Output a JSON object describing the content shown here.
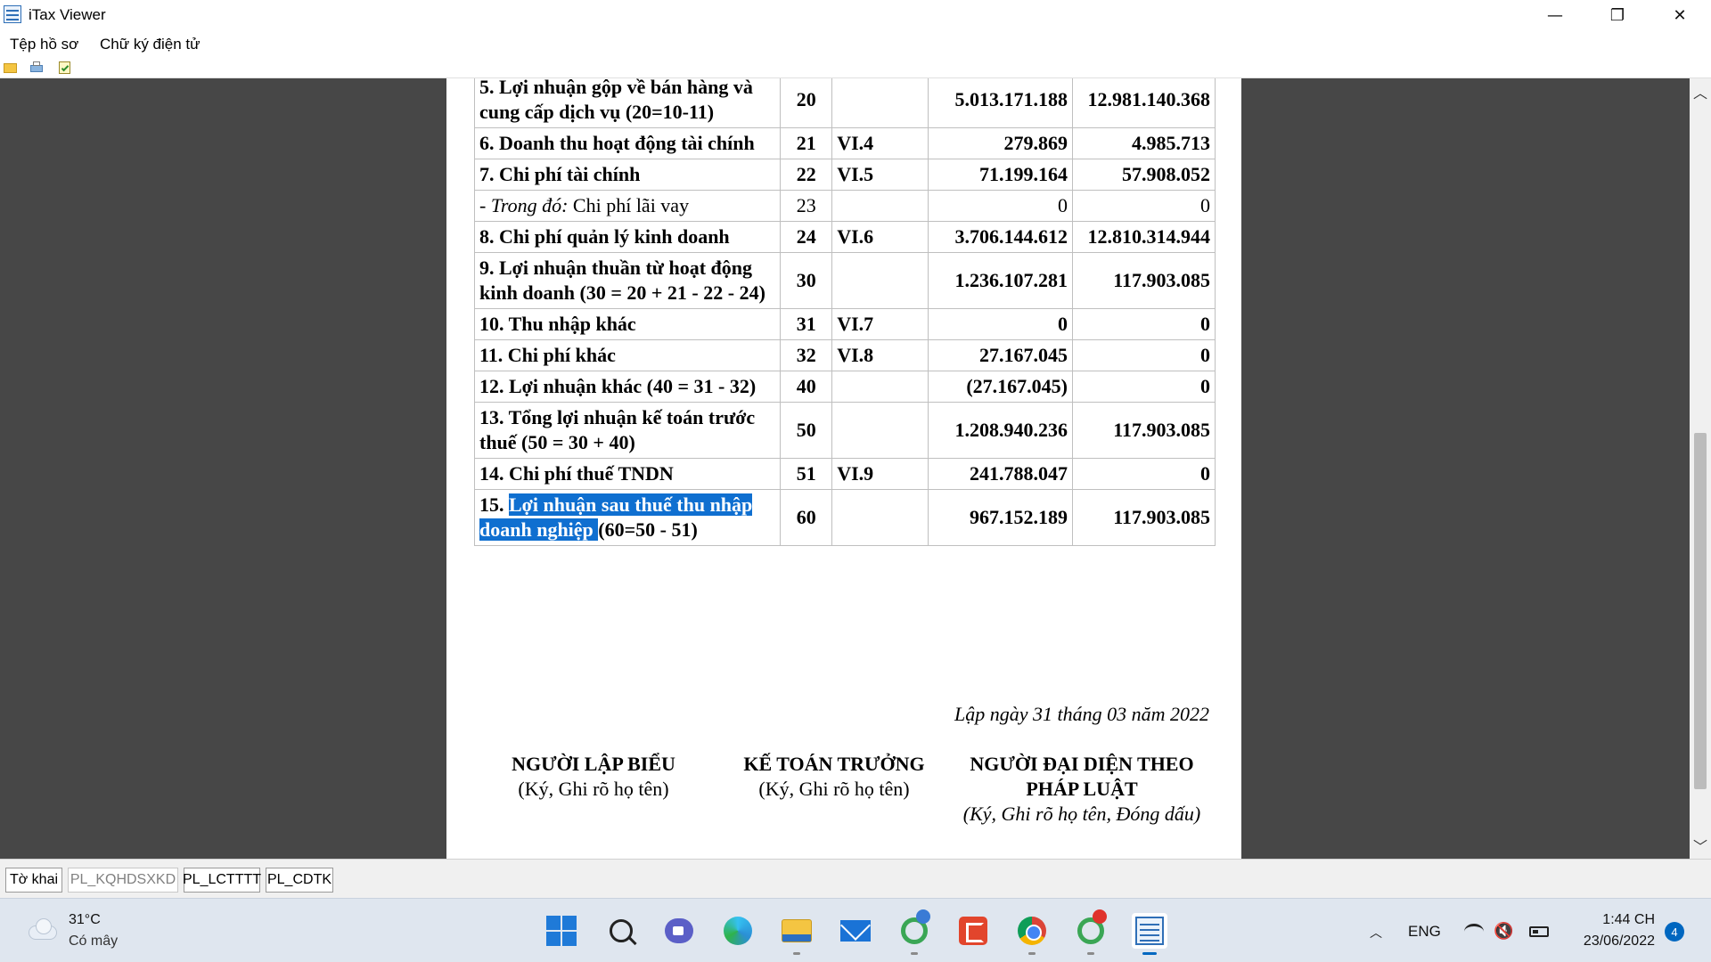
{
  "window": {
    "title": "iTax Viewer",
    "minimize_glyph": "—",
    "maximize_glyph": "❐",
    "close_glyph": "✕"
  },
  "menu": {
    "items": [
      "Tệp hồ sơ",
      "Chữ ký điện tử"
    ]
  },
  "toolbar": {
    "icons": [
      "open-folder-icon",
      "print-icon",
      "sign-document-icon"
    ]
  },
  "report": {
    "rows": [
      {
        "label": "5. Lợi nhuận gộp về bán hàng và cung cấp dịch vụ (20=10-11)",
        "code": "20",
        "note": "",
        "current": "5.013.171.188",
        "previous": "12.981.140.368"
      },
      {
        "label": "6. Doanh thu hoạt động tài chính",
        "code": "21",
        "note": "VI.4",
        "current": "279.869",
        "previous": "4.985.713"
      },
      {
        "label": "7. Chi phí tài chính",
        "code": "22",
        "note": "VI.5",
        "current": "71.199.164",
        "previous": "57.908.052"
      },
      {
        "label_prefix": "- ",
        "label_italic": "Trong đó:",
        "label_rest": " Chi phí lãi vay",
        "code": "23",
        "note": "",
        "current": "0",
        "previous": "0"
      },
      {
        "label": "8. Chi phí quản lý kinh doanh",
        "code": "24",
        "note": "VI.6",
        "current": "3.706.144.612",
        "previous": "12.810.314.944"
      },
      {
        "label": "9. Lợi nhuận thuần từ hoạt động kinh doanh (30 = 20 + 21 - 22 - 24)",
        "code": "30",
        "note": "",
        "current": "1.236.107.281",
        "previous": "117.903.085"
      },
      {
        "label": "10. Thu nhập khác",
        "code": "31",
        "note": "VI.7",
        "current": "0",
        "previous": "0"
      },
      {
        "label": "11. Chi phí khác",
        "code": "32",
        "note": "VI.8",
        "current": "27.167.045",
        "previous": "0"
      },
      {
        "label": "12. Lợi nhuận khác (40 = 31 - 32)",
        "code": "40",
        "note": "",
        "current": "(27.167.045)",
        "previous": "0"
      },
      {
        "label": "13. Tổng lợi nhuận kế toán trước thuế (50 = 30 + 40)",
        "code": "50",
        "note": "",
        "current": "1.208.940.236",
        "previous": "117.903.085"
      },
      {
        "label": "14. Chi phí thuế TNDN",
        "code": "51",
        "note": "VI.9",
        "current": "241.788.047",
        "previous": "0"
      },
      {
        "label_prefix": "15. ",
        "label_selected": "Lợi nhuận sau thuế thu nhập doanh nghiệp ",
        "label_rest": "(60=50 - 51)",
        "code": "60",
        "note": "",
        "current": "967.152.189",
        "previous": "117.903.085"
      }
    ],
    "date_line": "Lập ngày 31 tháng 03 năm 2022",
    "signatures": [
      {
        "title": "NGƯỜI LẬP BIỂU",
        "subtitle": "(Ký, Ghi rõ họ tên)"
      },
      {
        "title": "KẾ TOÁN TRƯỞNG",
        "subtitle": "(Ký, Ghi rõ họ tên)"
      },
      {
        "title": "NGƯỜI ĐẠI DIỆN THEO PHÁP LUẬT",
        "subtitle": "(Ký, Ghi rõ họ tên, Đóng dấu)"
      }
    ]
  },
  "scrollbar": {
    "up_glyph": "︿",
    "down_glyph": "﹀"
  },
  "sheet_tabs": [
    "Tờ khai",
    "PL_KQHDSXKD",
    "PL_LCTTTT",
    "PL_CDTK"
  ],
  "taskbar": {
    "weather": {
      "temp": "31°C",
      "desc": "Có mây"
    },
    "apps": [
      "windows-start-icon",
      "search-icon",
      "chat-icon",
      "edge-icon",
      "file-explorer-icon",
      "mail-icon",
      "green-app-icon",
      "snip-icon",
      "chrome-icon",
      "green-app-2-icon",
      "itax-viewer-icon"
    ],
    "tray": {
      "chevron": "︿",
      "language": "ENG",
      "volume_glyph": "🔇",
      "time": "1:44 CH",
      "date": "23/06/2022",
      "notifications": "4"
    }
  },
  "colors": {
    "selection": "#0f6fd0",
    "viewer_bg": "#474747",
    "taskbar_bg": "#dfe6ef",
    "accent": "#0067c0"
  }
}
